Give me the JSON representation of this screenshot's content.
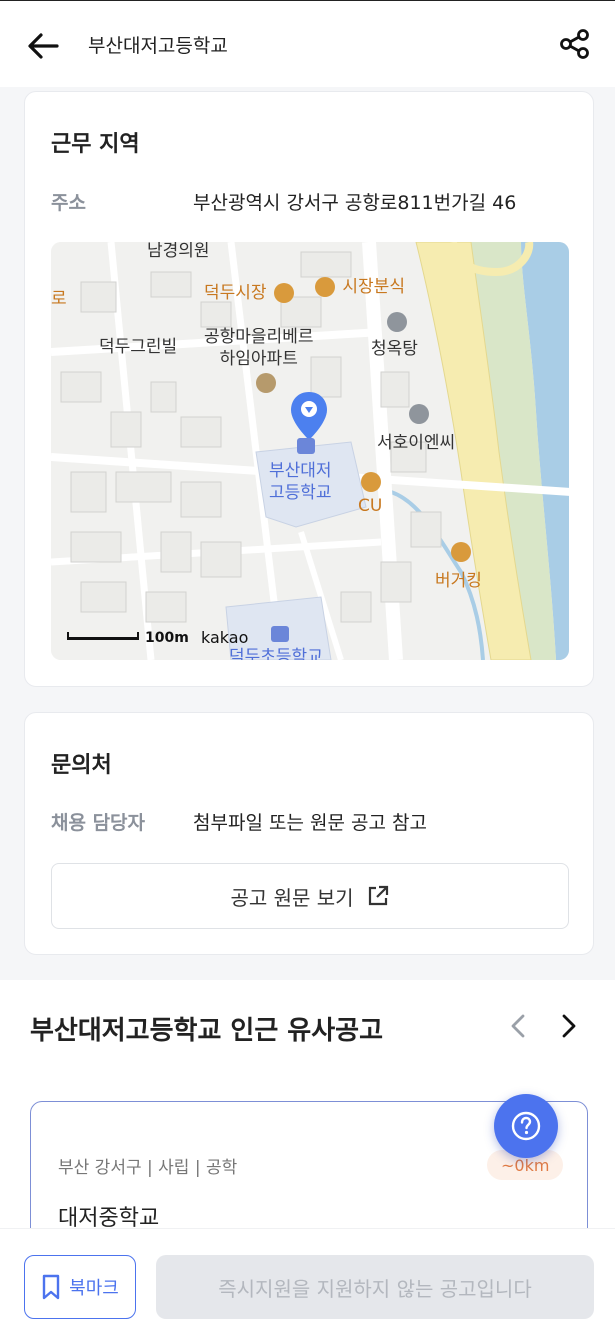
{
  "header": {
    "title": "부산대저고등학교",
    "back_icon": "arrow-left-icon",
    "share_icon": "share-icon"
  },
  "work_location": {
    "title": "근무 지역",
    "address_label": "주소",
    "address_value": "부산광역시 강서구 공항로811번가길 46",
    "map": {
      "pois": {
        "top_clinic": "남경의원",
        "left_edge": "로",
        "market": "덕두시장",
        "snack": "시장분식",
        "villa": "덕두그린빌",
        "apartment_line1": "공항마을리베르",
        "apartment_line2": "하임아파트",
        "bathhouse": "청옥탕",
        "building": "서호이엔씨",
        "school_line1": "부산대저",
        "school_line2": "고등학교",
        "store": "CU",
        "burger": "버거킹",
        "elementary": "덕두초등학교"
      },
      "scale_label": "100m",
      "provider": "kakao"
    }
  },
  "contact": {
    "title": "문의처",
    "manager_label": "채용 담당자",
    "manager_value": "첨부파일 또는 원문 공고 참고",
    "view_button": "공고 원문 보기",
    "external_icon": "external-link-icon"
  },
  "similar": {
    "title": "부산대저고등학교 인근 유사공고",
    "prev_icon": "chevron-left-icon",
    "next_icon": "chevron-right-icon",
    "card": {
      "meta": "부산 강서구 | 사립 | 공학",
      "distance": "~0km",
      "name": "대저중학교"
    }
  },
  "bottom": {
    "bookmark_label": "북마크",
    "apply_label": "즉시지원을 지원하지 않는 공고입니다"
  },
  "colors": {
    "accent": "#4c73ee",
    "poi_brown": "#c8781f",
    "road_yellow": "#f6ecb0",
    "park_green": "#d9e6c8",
    "water_blue": "#a9cde6"
  }
}
